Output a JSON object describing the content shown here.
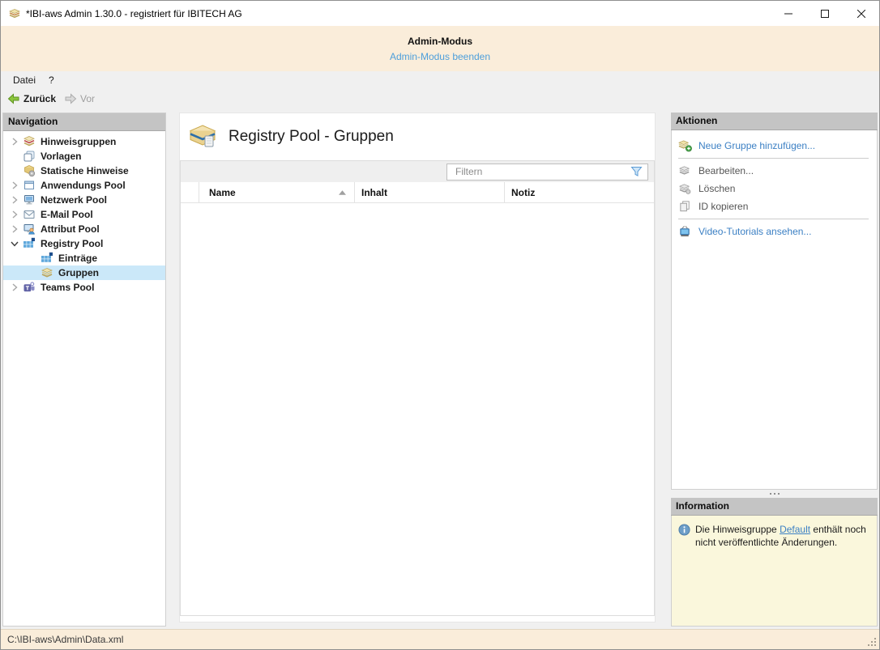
{
  "window": {
    "title": "*IBI-aws Admin 1.30.0 - registriert für IBITECH AG"
  },
  "banner": {
    "title": "Admin-Modus",
    "exit_link": "Admin-Modus beenden"
  },
  "menubar": {
    "items": [
      {
        "label": "Datei"
      },
      {
        "label": "?"
      }
    ]
  },
  "toolbar": {
    "back_label": "Zurück",
    "forward_label": "Vor"
  },
  "navigation": {
    "header": "Navigation",
    "items": [
      {
        "label": "Hinweisgruppen",
        "icon": "hint-groups-icon",
        "state": "collapsed",
        "level": 0,
        "selected": false
      },
      {
        "label": "Vorlagen",
        "icon": "templates-icon",
        "state": "none",
        "level": 0,
        "selected": false
      },
      {
        "label": "Statische Hinweise",
        "icon": "static-hints-icon",
        "state": "none",
        "level": 0,
        "selected": false
      },
      {
        "label": "Anwendungs Pool",
        "icon": "application-pool-icon",
        "state": "collapsed",
        "level": 0,
        "selected": false
      },
      {
        "label": "Netzwerk Pool",
        "icon": "network-pool-icon",
        "state": "collapsed",
        "level": 0,
        "selected": false
      },
      {
        "label": "E-Mail Pool",
        "icon": "email-pool-icon",
        "state": "collapsed",
        "level": 0,
        "selected": false
      },
      {
        "label": "Attribut Pool",
        "icon": "attribute-pool-icon",
        "state": "collapsed",
        "level": 0,
        "selected": false
      },
      {
        "label": "Registry Pool",
        "icon": "registry-pool-icon",
        "state": "expanded",
        "level": 0,
        "selected": false
      },
      {
        "label": "Einträge",
        "icon": "registry-entries-icon",
        "state": "none",
        "level": 1,
        "selected": false
      },
      {
        "label": "Gruppen",
        "icon": "groups-icon",
        "state": "none",
        "level": 1,
        "selected": true
      },
      {
        "label": "Teams Pool",
        "icon": "teams-pool-icon",
        "state": "collapsed",
        "level": 0,
        "selected": false
      }
    ]
  },
  "main": {
    "title": "Registry Pool - Gruppen",
    "filter": {
      "placeholder": "Filtern"
    },
    "table": {
      "columns": [
        {
          "label": "Name",
          "sorted": "ascending"
        },
        {
          "label": "Inhalt"
        },
        {
          "label": "Notiz"
        }
      ],
      "rows": []
    }
  },
  "actions": {
    "header": "Aktionen",
    "items": [
      {
        "label": "Neue Gruppe hinzufügen...",
        "style": "link",
        "icon": "add-group-icon"
      },
      {
        "label": "Bearbeiten...",
        "style": "normal",
        "icon": "edit-group-icon"
      },
      {
        "label": "Löschen",
        "style": "normal",
        "icon": "delete-group-icon"
      },
      {
        "label": "ID kopieren",
        "style": "normal",
        "icon": "copy-id-icon"
      },
      {
        "label": "Video-Tutorials ansehen...",
        "style": "link",
        "icon": "video-tutorials-icon"
      }
    ]
  },
  "information": {
    "header": "Information",
    "message_before": "Die Hinweisgruppe ",
    "message_link": "Default",
    "message_after": " enthält noch nicht veröffentlichte Änderungen."
  },
  "statusbar": {
    "path": "C:\\IBI-aws\\Admin\\Data.xml"
  },
  "colors": {
    "banner_bg": "#FAEDDA",
    "statusbar_bg": "#FAEDDA",
    "panel_header_bg": "#C4C4C4",
    "selected_tree_row_bg": "#CBE8F9",
    "action_link_blue": "#3C80C4",
    "banner_link_blue": "#4E9FDB",
    "info_panel_bg": "#FAF7DC",
    "icon_accent_blue": "#5FA8DC"
  }
}
